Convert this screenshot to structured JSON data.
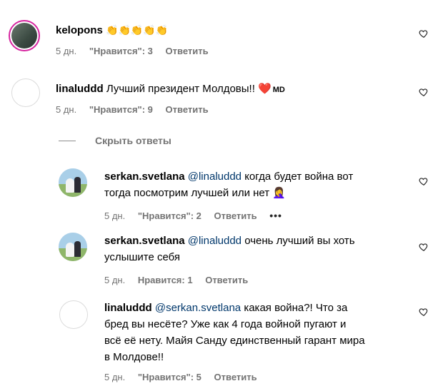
{
  "comments": [
    {
      "username": "kelopons",
      "text": "👏👏👏👏👏",
      "time": "5 дн.",
      "likes": "\"Нравится\": 3",
      "reply": "Ответить"
    },
    {
      "username": "linaluddd",
      "text": "Лучший президент Молдовы!! ❤️",
      "flag": "MD",
      "time": "5 дн.",
      "likes": "\"Нравится\": 9",
      "reply": "Ответить"
    },
    {
      "username": "serkan.svetlana",
      "mention": "@linaluddd",
      "text_line1": "когда будет война вот",
      "text_line2": "тогда посмотрим лучшей или нет 🤦‍♀️",
      "time": "5 дн.",
      "likes": "\"Нравится\": 2",
      "reply": "Ответить",
      "more": "•••"
    },
    {
      "username": "serkan.svetlana",
      "mention": "@linaluddd",
      "text_line1": "очень лучший вы хоть",
      "text_line2": "услышите себя",
      "time": "5 дн.",
      "likes": "Нравится: 1",
      "reply": "Ответить"
    },
    {
      "username": "linaluddd",
      "mention": "@serkan.svetlana",
      "text_line1": "какая война?! Что за",
      "text_line2": "бред вы несёте? Уже как 4 года войной пугают и",
      "text_line3": "всё её нету. Майя Санду единственный гарант мира",
      "text_line4": "в Молдове!!",
      "time": "5 дн.",
      "likes": "\"Нравится\": 5",
      "reply": "Ответить"
    }
  ],
  "hide_replies": "Скрыть ответы",
  "colors": {
    "mention": "#00376b",
    "meta": "#737373",
    "ring": "#d6249f"
  }
}
